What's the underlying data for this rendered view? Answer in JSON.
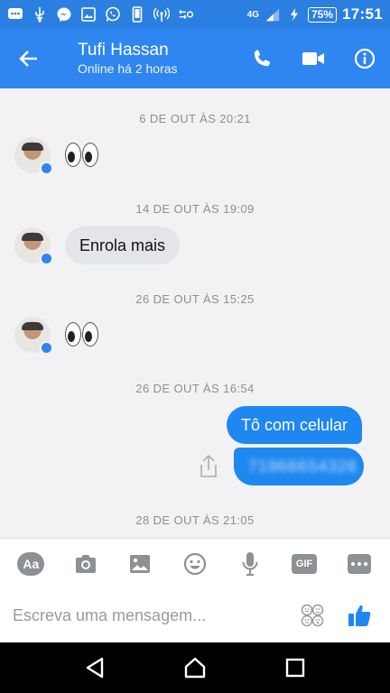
{
  "status_bar": {
    "network": "4G",
    "battery": "75%",
    "time": "17:51"
  },
  "header": {
    "contact_name": "Tufi Hassan",
    "contact_status": "Online há 2 horas"
  },
  "messages": [
    {
      "timestamp": "6 DE OUT ÀS 20:21",
      "sender": "contact",
      "kind": "emoji"
    },
    {
      "timestamp": "14 DE OUT ÀS 19:09",
      "sender": "contact",
      "kind": "text",
      "text": "Enrola mais"
    },
    {
      "timestamp": "26 DE OUT ÀS 15:25",
      "sender": "contact",
      "kind": "emoji"
    },
    {
      "timestamp": "26 DE OUT ÀS 16:54",
      "sender": "me",
      "kind": "text",
      "text": "Tô com celular",
      "second_text": "71966654326"
    },
    {
      "timestamp": "28 DE OUT ÀS 21:05"
    }
  ],
  "composer": {
    "text_format_label": "Aa",
    "gif_label": "GIF",
    "placeholder": "Escreva uma mensagem..."
  },
  "colors": {
    "brand_blue": "#2f86f0",
    "outgoing_bubble": "#1e88f0",
    "incoming_bubble": "#e4e5e8"
  },
  "icons": {
    "header": [
      "back-arrow-icon",
      "phone-icon",
      "video-camera-icon",
      "info-icon"
    ],
    "toolbar": [
      "text-format-icon",
      "camera-icon",
      "image-icon",
      "emoji-icon",
      "microphone-icon",
      "gif-icon",
      "more-icon"
    ],
    "input": [
      "stickers-icon",
      "thumbs-up-icon"
    ],
    "nav": [
      "back-nav-icon",
      "home-nav-icon",
      "recents-nav-icon"
    ]
  }
}
